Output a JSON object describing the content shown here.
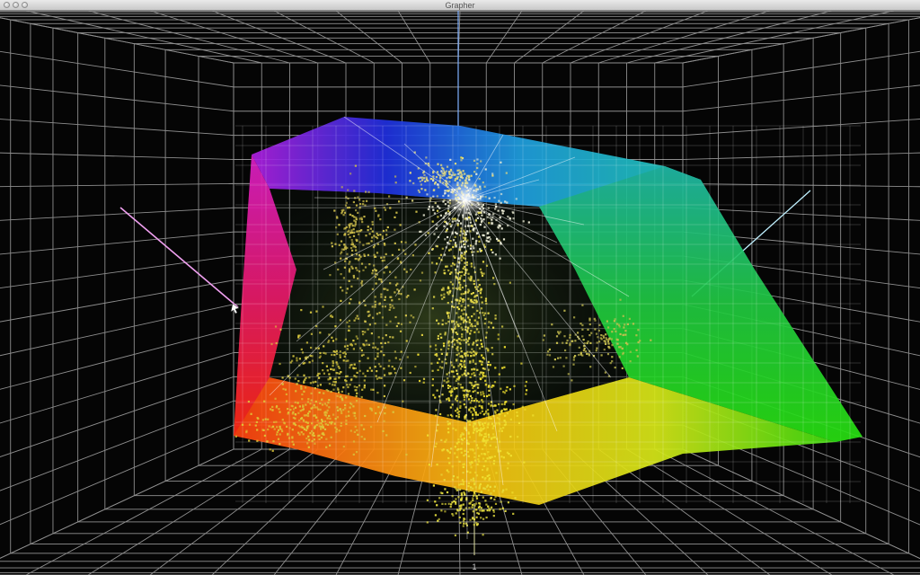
{
  "window": {
    "title": "Grapher"
  },
  "plot": {
    "type": "3d-gamut-scatter",
    "background": "#050505",
    "grid_color": "#9a9a9a",
    "point_color": "#e6d84a",
    "highlight_color": "#ffffff",
    "gamut_colors": {
      "magenta": "#e020d0",
      "blue": "#2030e0",
      "cyan": "#20c0e0",
      "green": "#20d020",
      "yellow": "#f0e020",
      "red": "#ff2020"
    },
    "axis_tick_label": "1"
  }
}
